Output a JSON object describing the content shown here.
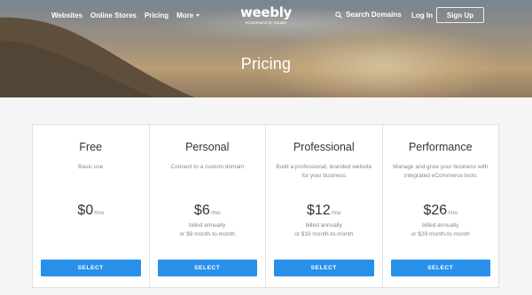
{
  "nav": {
    "links": [
      "Websites",
      "Online Stores",
      "Pricing",
      "More"
    ],
    "logo": {
      "wordmark": "weebly",
      "tagline": "eCommerce by Square"
    },
    "search_label": "Search Domains",
    "login_label": "Log In",
    "signup_label": "Sign Up"
  },
  "hero": {
    "title": "Pricing"
  },
  "plans": [
    {
      "name": "Free",
      "description": "Basic use",
      "price": "$0",
      "period": "/mo",
      "billing": [
        "",
        ""
      ],
      "button": "SELECT"
    },
    {
      "name": "Personal",
      "description": "Connect to a custom domain",
      "price": "$6",
      "period": "/mo",
      "billing": [
        "billed annually",
        "or $9 month-to-month"
      ],
      "button": "SELECT"
    },
    {
      "name": "Professional",
      "description": "Build a professional, branded website for your business",
      "price": "$12",
      "period": "/mo",
      "billing": [
        "billed annually",
        "or $16 month-to-month"
      ],
      "button": "SELECT"
    },
    {
      "name": "Performance",
      "description": "Manage and grow your business with integrated eCommerce tools",
      "price": "$26",
      "period": "/mo",
      "billing": [
        "billed annually",
        "or $29 month-to-month"
      ],
      "button": "SELECT"
    }
  ],
  "colors": {
    "accent": "#2990ea",
    "text": "#333333",
    "muted": "#888888"
  }
}
